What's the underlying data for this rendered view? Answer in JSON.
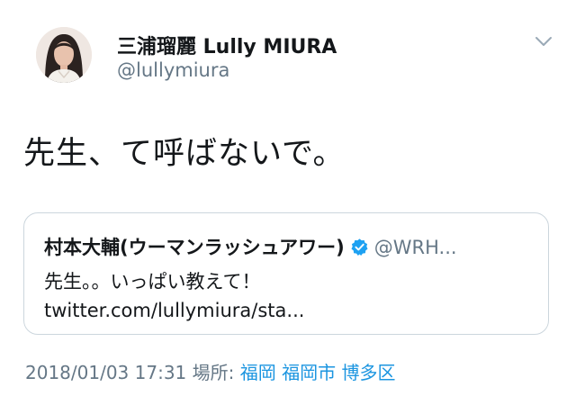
{
  "author": {
    "display_name": "三浦瑠麗 Lully MIURA",
    "handle": "@lullymiura",
    "avatar_icon": "profile-photo"
  },
  "menu_icon": "chevron-down-icon",
  "tweet": {
    "text": "先生、て呼ばないで。"
  },
  "quote": {
    "display_name": "村本大輔(ウーマンラッシュアワー)",
    "verified_icon": "verified-badge-icon",
    "handle": "@WRH...",
    "text": "先生。。いっぱい教えて！ twitter.com/lullymiura/sta..."
  },
  "meta": {
    "timestamp": "2018/01/03 17:31",
    "location_label": "場所:",
    "places": [
      "福岡",
      "福岡市",
      "博多区"
    ]
  },
  "colors": {
    "link": "#1b95e0",
    "secondary_text": "#657786",
    "border": "#ccd6dd",
    "verified": "#1da1f2"
  }
}
